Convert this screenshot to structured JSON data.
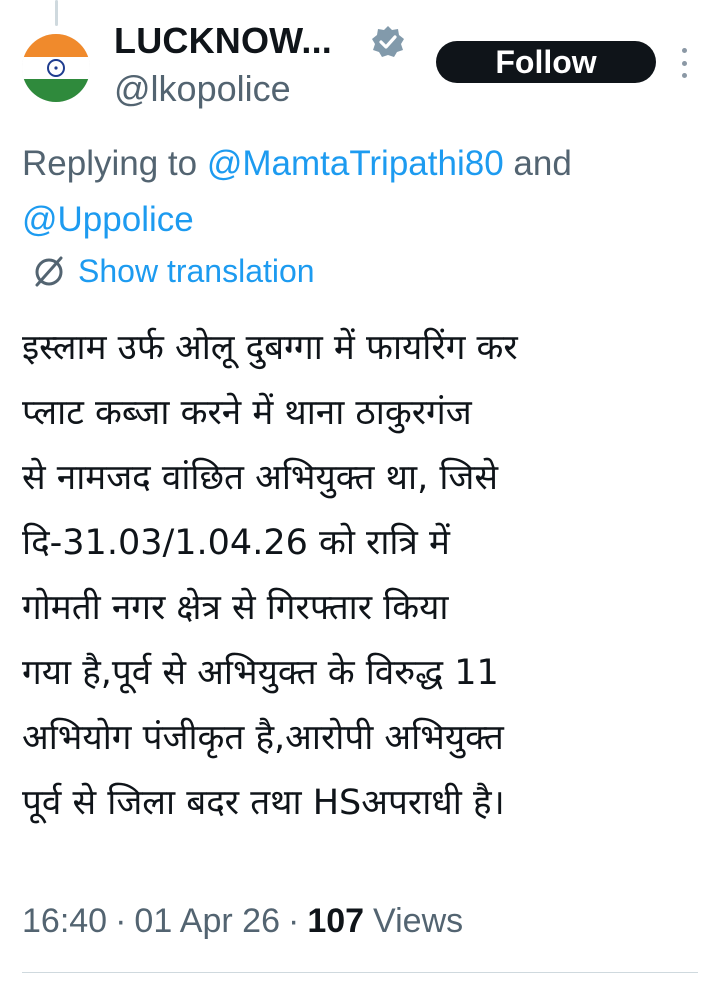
{
  "tweet": {
    "display_name": "LUCKNOW...",
    "handle": "@lkopolice",
    "follow_label": "Follow",
    "replying_prefix": "Replying to ",
    "reply_mention_1": "@MamtaTripathi80",
    "reply_and": " and",
    "reply_mention_2": "@Uppolice",
    "show_translation": "Show translation",
    "text": "इस्लाम उर्फ ओलू दुबग्गा में फायरिंग कर\nप्लाट कब्जा करने में थाना ठाकुरगंज\nसे नामजद वांछित अभियुक्त था, जिसे\nदि-31.03/1.04.26 को रात्रि में\nगोमती नगर क्षेत्र से गिरफ्तार किया\nगया है,पूर्व से अभियुक्त के विरुद्ध 11\nअभियोग पंजीकृत है,आरोपी अभियुक्त\nपूर्व से जिला बदर तथा HSअपराधी है।",
    "time": "16:40",
    "date": "01 Apr 26",
    "separator": "·",
    "view_count": "107",
    "views_label": "Views"
  },
  "icons": {
    "verified": "verified-badge-icon",
    "translate": "translate-icon",
    "more": "more-options-icon"
  },
  "colors": {
    "link": "#1d9bf0",
    "secondary_text": "#536471",
    "primary_text": "#0f1419",
    "follow_bg": "#0f1419"
  }
}
